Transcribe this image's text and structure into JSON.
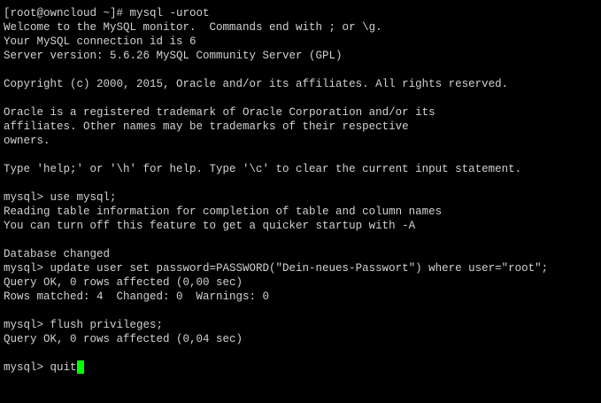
{
  "terminal": {
    "colors": {
      "background": "#000000",
      "foreground": "#d2d2d2",
      "cursor": "#00ff00"
    },
    "lines": [
      "[root@owncloud ~]# mysql -uroot",
      "Welcome to the MySQL monitor.  Commands end with ; or \\g.",
      "Your MySQL connection id is 6",
      "Server version: 5.6.26 MySQL Community Server (GPL)",
      "",
      "Copyright (c) 2000, 2015, Oracle and/or its affiliates. All rights reserved.",
      "",
      "Oracle is a registered trademark of Oracle Corporation and/or its",
      "affiliates. Other names may be trademarks of their respective",
      "owners.",
      "",
      "Type 'help;' or '\\h' for help. Type '\\c' to clear the current input statement.",
      "",
      "mysql> use mysql;",
      "Reading table information for completion of table and column names",
      "You can turn off this feature to get a quicker startup with -A",
      "",
      "Database changed",
      "mysql> update user set password=PASSWORD(\"Dein-neues-Passwort\") where user=\"root\";",
      "Query OK, 0 rows affected (0,00 sec)",
      "Rows matched: 4  Changed: 0  Warnings: 0",
      "",
      "mysql> flush privileges;",
      "Query OK, 0 rows affected (0,04 sec)",
      ""
    ],
    "prompt": {
      "text": "mysql> quit"
    }
  }
}
